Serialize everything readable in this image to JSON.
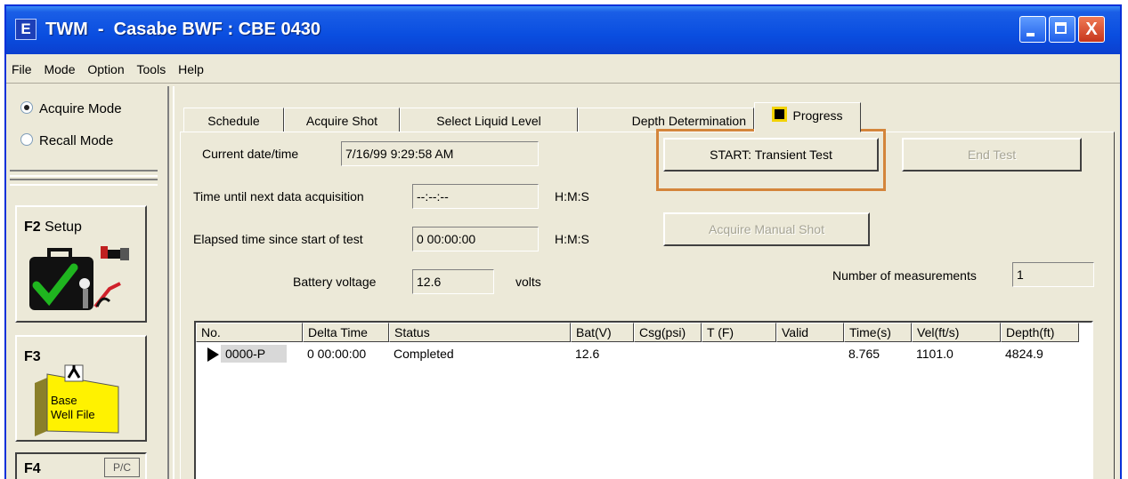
{
  "window": {
    "title": "TWM  -  Casabe BWF : CBE 0430",
    "app_icon_glyph": "E"
  },
  "titlebar_buttons": {
    "close_glyph": "X"
  },
  "menu": [
    "File",
    "Mode",
    "Option",
    "Tools",
    "Help"
  ],
  "left": {
    "acquire_mode": "Acquire Mode",
    "recall_mode": "Recall Mode",
    "f2_key": "F2",
    "f2_label": "Setup",
    "f3_key": "F3",
    "f3_folder_line1": "Base",
    "f3_folder_line2": "Well File",
    "f4_key": "F4",
    "f4_badge": "P/C"
  },
  "tabs": [
    "Schedule",
    "Acquire Shot",
    "Select Liquid Level",
    "Depth Determination",
    "Progress"
  ],
  "progress": {
    "current_datetime_label": "Current date/time",
    "current_datetime_value": "7/16/99 9:29:58 AM",
    "time_until_label": "Time until next data acquisition",
    "time_until_value": "--:--:--",
    "time_until_unit": "H:M:S",
    "elapsed_label": "Elapsed time since start of test",
    "elapsed_value": "0 00:00:00",
    "elapsed_unit": "H:M:S",
    "battery_label": "Battery voltage",
    "battery_value": "12.6",
    "battery_unit": "volts",
    "start_button": "START: Transient Test",
    "end_button": "End Test",
    "acquire_manual_button": "Acquire Manual Shot",
    "num_measurements_label": "Number of measurements",
    "num_measurements_value": "1"
  },
  "table": {
    "columns": [
      "No.",
      "Delta Time",
      "Status",
      "Bat(V)",
      "Csg(psi)",
      "T (F)",
      "Valid",
      "Time(s)",
      "Vel(ft/s)",
      "Depth(ft)"
    ],
    "rows": [
      {
        "no": "0000-P",
        "delta": "0 00:00:00",
        "status": "Completed",
        "bat": "12.6",
        "csg": "",
        "t": "",
        "valid": "",
        "time": "8.765",
        "vel": "1101.0",
        "depth": "4824.9"
      }
    ]
  },
  "colors": {
    "title_bar": "#0a4ee0",
    "highlight_border": "#d4853b",
    "folder": "#fff200"
  }
}
